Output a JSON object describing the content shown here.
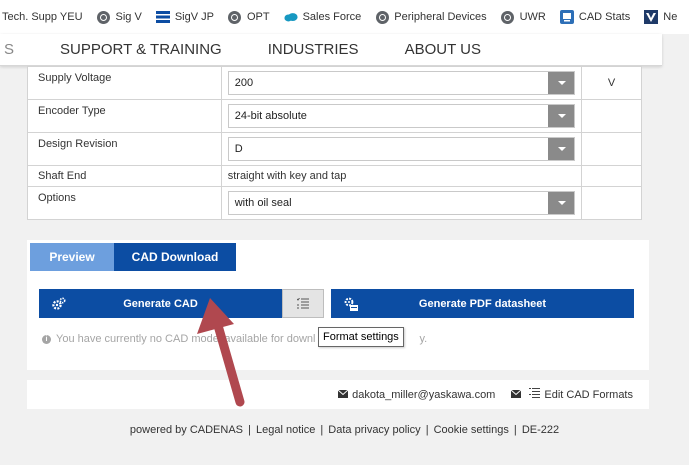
{
  "bookmarks": [
    {
      "label": "Tech. Supp YEU",
      "icon": "none"
    },
    {
      "label": "Sig V",
      "icon": "globe-icon"
    },
    {
      "label": "SigV JP",
      "icon": "yaskawa-logo-icon"
    },
    {
      "label": "OPT",
      "icon": "globe-icon"
    },
    {
      "label": "Sales Force",
      "icon": "salesforce-cloud-icon"
    },
    {
      "label": "Peripheral Devices",
      "icon": "globe-icon"
    },
    {
      "label": "UWR",
      "icon": "globe-icon"
    },
    {
      "label": "CAD Stats",
      "icon": "chart-app-icon"
    },
    {
      "label": "Ne",
      "icon": "v-logo-icon"
    }
  ],
  "nav": {
    "edge": "S",
    "items": [
      "SUPPORT & TRAINING",
      "INDUSTRIES",
      "ABOUT US"
    ]
  },
  "properties": [
    {
      "label": "Supply Voltage",
      "value": "200",
      "type": "select",
      "unit": "V"
    },
    {
      "label": "Encoder Type",
      "value": "24-bit absolute",
      "type": "select",
      "unit": ""
    },
    {
      "label": "Design Revision",
      "value": "D",
      "type": "select",
      "unit": ""
    },
    {
      "label": "Shaft End",
      "value": "straight with key and tap",
      "type": "text",
      "unit": ""
    },
    {
      "label": "Options",
      "value": "with oil seal",
      "type": "select",
      "unit": ""
    }
  ],
  "cad": {
    "tab_preview": "Preview",
    "tab_download": "CAD Download",
    "generate_cad": "Generate CAD",
    "generate_pdf": "Generate PDF datasheet",
    "info_text": "You have currently no CAD model available for downl",
    "info_suffix": "y.",
    "tooltip": "Format settings"
  },
  "footer": {
    "email": "dakota_miller@yaskawa.com",
    "edit_formats": "Edit CAD Formats"
  },
  "legal": {
    "powered": "powered by CADENAS",
    "links": [
      "Legal notice",
      "Data privacy policy",
      "Cookie settings",
      "DE-222"
    ],
    "separator": "|"
  },
  "colors": {
    "primary_blue": "#0c4da3",
    "preview_blue": "#6d9fde",
    "arrow_red": "#b0484f"
  }
}
